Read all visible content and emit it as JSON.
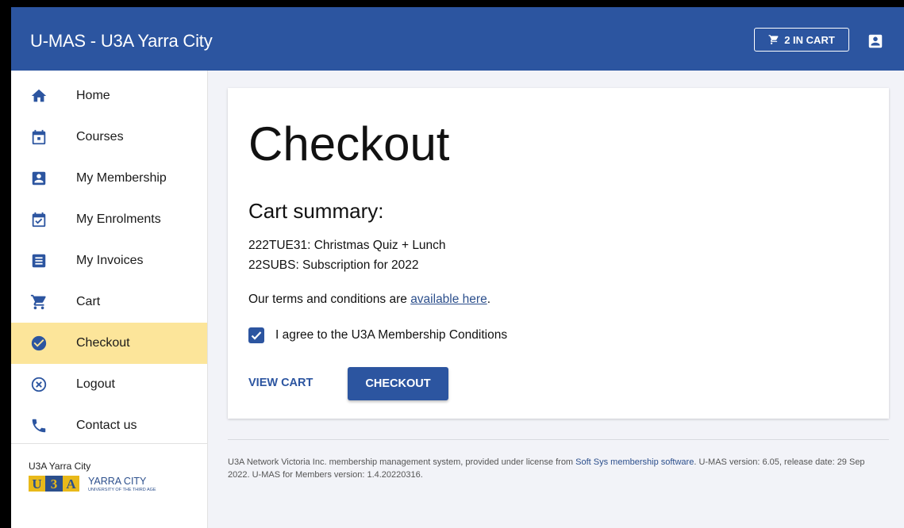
{
  "header": {
    "title": "U-MAS - U3A Yarra City",
    "cart_label": "2 IN CART",
    "cart_icon": "cart-icon",
    "user_icon": "account-box-icon"
  },
  "sidebar": {
    "items": [
      {
        "label": "Home",
        "icon": "home-icon"
      },
      {
        "label": "Courses",
        "icon": "calendar-icon"
      },
      {
        "label": "My Membership",
        "icon": "account-box-icon"
      },
      {
        "label": "My Enrolments",
        "icon": "calendar-check-icon"
      },
      {
        "label": "My Invoices",
        "icon": "receipt-icon"
      },
      {
        "label": "Cart",
        "icon": "cart-icon"
      },
      {
        "label": "Checkout",
        "icon": "check-circle-icon",
        "active": true
      },
      {
        "label": "Logout",
        "icon": "close-circle-icon"
      },
      {
        "label": "Contact us",
        "icon": "phone-icon"
      }
    ],
    "org_name": "U3A Yarra City",
    "logo": {
      "text": "U3A",
      "name": "YARRA CITY",
      "tagline": "UNIVERSITY OF THE THIRD AGE"
    }
  },
  "main": {
    "title": "Checkout",
    "summary_title": "Cart summary:",
    "items": [
      "222TUE31: Christmas Quiz + Lunch",
      "22SUBS: Subscription for 2022"
    ],
    "terms_prefix": "Our terms and conditions are ",
    "terms_link": "available here",
    "terms_suffix": ".",
    "agree_label": "I agree to the U3A Membership Conditions",
    "agree_checked": true,
    "view_cart_label": "VIEW CART",
    "checkout_label": "CHECKOUT"
  },
  "footer": {
    "text1": "U3A Network Victoria Inc. membership management system, provided under license from ",
    "link": "Soft Sys membership software",
    "text2": ". U-MAS version: 6.05, release date: 29 Sep 2022. U-MAS for Members version: 1.4.20220316."
  },
  "colors": {
    "primary": "#2c55a0",
    "active_nav": "#fce59a",
    "background": "#f2f3f8"
  }
}
